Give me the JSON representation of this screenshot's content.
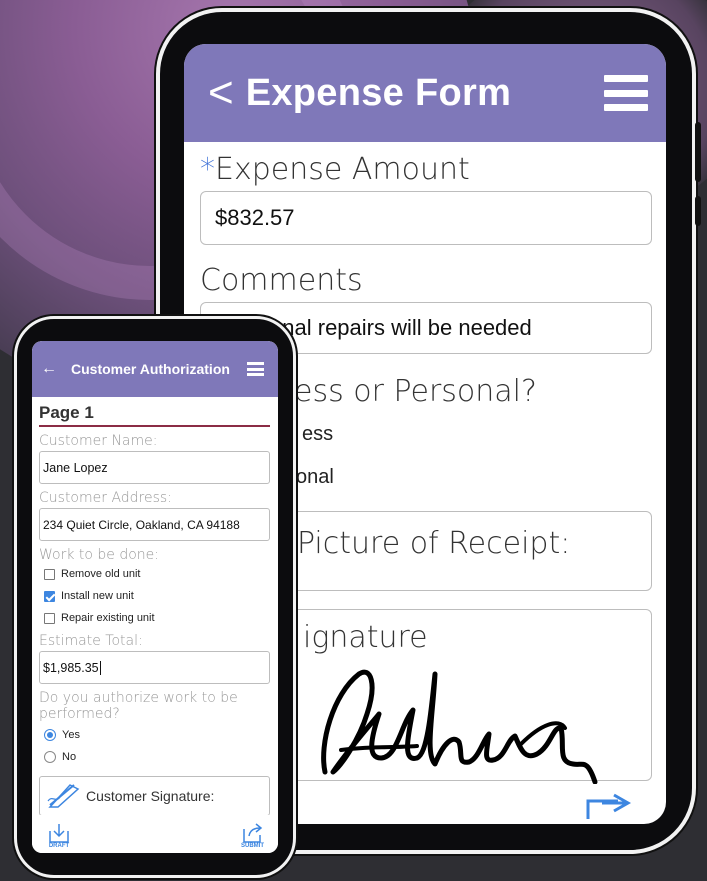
{
  "tablet": {
    "header": {
      "back_glyph": "<",
      "title": "Expense Form"
    },
    "fields": {
      "amount_required_marker": "*",
      "amount_label": "Expense Amount",
      "amount_value": "$832.57",
      "comments_label": "Comments",
      "comments_value": "Additional repairs will be needed",
      "type_label": "ess or Personal?",
      "type_option_1": "ess",
      "type_option_2": "onal",
      "receipt_label": "Picture of Receipt:",
      "signature_label": "ignature"
    }
  },
  "phone": {
    "header": {
      "back_glyph": "←",
      "title": "Customer Authorization"
    },
    "page_title": "Page 1",
    "customer_name_label": "Customer Name:",
    "customer_name_value": "Jane Lopez",
    "customer_address_label": "Customer Address:",
    "customer_address_value": "234 Quiet Circle, Oakland, CA 94188",
    "work_label": "Work to be done:",
    "work_options": [
      {
        "label": "Remove old unit",
        "checked": false
      },
      {
        "label": "Install new unit",
        "checked": true
      },
      {
        "label": "Repair existing unit",
        "checked": false
      }
    ],
    "estimate_label": "Estimate Total:",
    "estimate_value": "$1,985.35",
    "authorize_label": "Do you authorize work to be performed?",
    "authorize_options": [
      {
        "label": "Yes",
        "selected": true
      },
      {
        "label": "No",
        "selected": false
      }
    ],
    "signature_label": "Customer Signature:",
    "footer": {
      "draft_label": "DRAFT",
      "submit_label": "SUBMIT"
    }
  },
  "colors": {
    "header": "#7f78b9",
    "accent": "#3d86e0",
    "page_rule": "#8b2c45"
  },
  "icons": {
    "tablet_menu": "hamburger-icon",
    "phone_menu": "hamburger-icon",
    "draft": "draft-download-icon",
    "submit": "submit-share-icon",
    "signature": "pen-icon"
  }
}
